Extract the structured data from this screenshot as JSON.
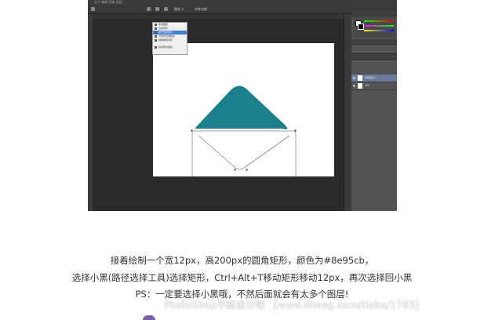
{
  "ps_window": {
    "menu_text": "文件 编辑 图像 图层",
    "option_labels": [
      "路径 ↕",
      "对齐边缘"
    ]
  },
  "path_ops_menu": {
    "items": [
      "新建图层",
      "合并形状",
      "减去顶层形状",
      "与形状区域相交",
      "排除重叠形状",
      "合并形状组件"
    ],
    "selected_index": 2
  },
  "layers_panel": {
    "rows": [
      "圆角矩形 1",
      "背景"
    ]
  },
  "shape": {
    "fill_color": "#1a808c",
    "path_color": "#888888"
  },
  "caption": {
    "line1": "接着绘制一个宽12px，高200px的圆角矩形，颜色为#8e95cb，",
    "line2": "选择小黑(路径选择工具)选择矩形，Ctrl+Alt+T移动矩形移动12px，再次选择回小黑",
    "line3": "PS：一定要选择小黑哦，不然后面就会有太多个图层!"
  },
  "watermark": {
    "text": "PhotoShop平面设计吧 【www.lineeg.com/tieba/1783】"
  }
}
